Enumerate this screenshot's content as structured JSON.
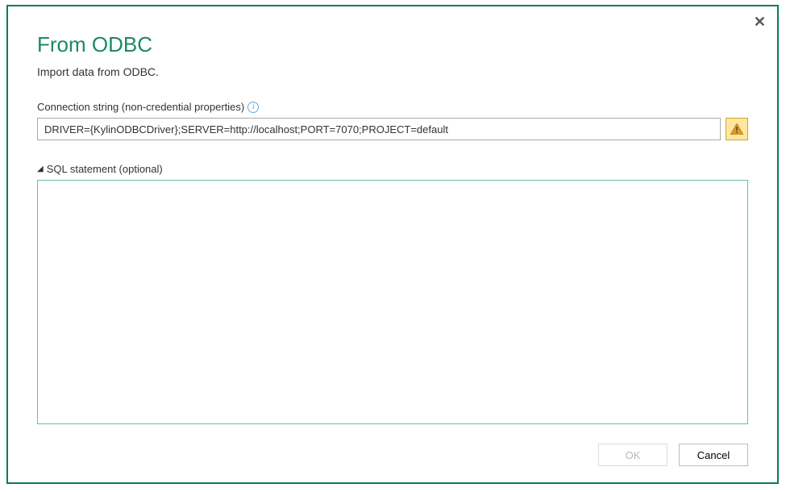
{
  "dialog": {
    "title": "From ODBC",
    "subtitle": "Import data from ODBC.",
    "connection": {
      "label": "Connection string (non-credential properties)",
      "value": "DRIVER={KylinODBCDriver};SERVER=http://localhost;PORT=7070;PROJECT=default",
      "info_icon": "i",
      "warning_icon": "warning"
    },
    "sql": {
      "label": "SQL statement (optional)",
      "value": ""
    },
    "buttons": {
      "ok": "OK",
      "cancel": "Cancel"
    },
    "close": "✕"
  }
}
